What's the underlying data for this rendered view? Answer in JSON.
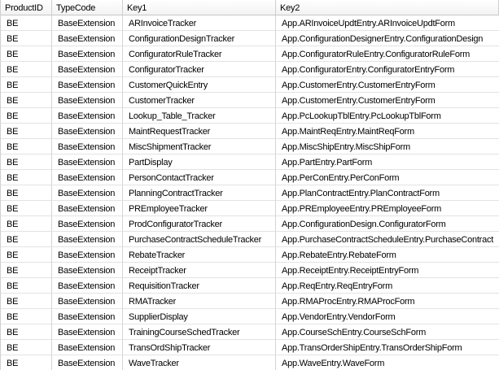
{
  "grid": {
    "columns": [
      "ProductID",
      "TypeCode",
      "Key1",
      "Key2"
    ],
    "rows": [
      {
        "productid": "BE",
        "typecode": "BaseExtension",
        "key1": "ARInvoiceTracker",
        "key2": "App.ARInvoiceUpdtEntry.ARInvoiceUpdtForm"
      },
      {
        "productid": "BE",
        "typecode": "BaseExtension",
        "key1": "ConfigurationDesignTracker",
        "key2": "App.ConfigurationDesignerEntry.ConfigurationDesign"
      },
      {
        "productid": "BE",
        "typecode": "BaseExtension",
        "key1": "ConfiguratorRuleTracker",
        "key2": "App.ConfiguratorRuleEntry.ConfiguratorRuleForm"
      },
      {
        "productid": "BE",
        "typecode": "BaseExtension",
        "key1": "ConfiguratorTracker",
        "key2": "App.ConfiguratorEntry.ConfiguratorEntryForm"
      },
      {
        "productid": "BE",
        "typecode": "BaseExtension",
        "key1": "CustomerQuickEntry",
        "key2": "App.CustomerEntry.CustomerEntryForm"
      },
      {
        "productid": "BE",
        "typecode": "BaseExtension",
        "key1": "CustomerTracker",
        "key2": "App.CustomerEntry.CustomerEntryForm"
      },
      {
        "productid": "BE",
        "typecode": "BaseExtension",
        "key1": "Lookup_Table_Tracker",
        "key2": "App.PcLookupTblEntry.PcLookupTblForm"
      },
      {
        "productid": "BE",
        "typecode": "BaseExtension",
        "key1": "MaintRequestTracker",
        "key2": "App.MaintReqEntry.MaintReqForm"
      },
      {
        "productid": "BE",
        "typecode": "BaseExtension",
        "key1": "MiscShipmentTracker",
        "key2": "App.MiscShipEntry.MiscShipForm"
      },
      {
        "productid": "BE",
        "typecode": "BaseExtension",
        "key1": "PartDisplay",
        "key2": "App.PartEntry.PartForm"
      },
      {
        "productid": "BE",
        "typecode": "BaseExtension",
        "key1": "PersonContactTracker",
        "key2": "App.PerConEntry.PerConForm"
      },
      {
        "productid": "BE",
        "typecode": "BaseExtension",
        "key1": "PlanningContractTracker",
        "key2": "App.PlanContractEntry.PlanContractForm"
      },
      {
        "productid": "BE",
        "typecode": "BaseExtension",
        "key1": "PREmployeeTracker",
        "key2": "App.PREmployeeEntry.PREmployeeForm"
      },
      {
        "productid": "BE",
        "typecode": "BaseExtension",
        "key1": "ProdConfiguratorTracker",
        "key2": "App.ConfigurationDesign.ConfiguratorForm"
      },
      {
        "productid": "BE",
        "typecode": "BaseExtension",
        "key1": "PurchaseContractScheduleTracker",
        "key2": "App.PurchaseContractScheduleEntry.PurchaseContract"
      },
      {
        "productid": "BE",
        "typecode": "BaseExtension",
        "key1": "RebateTracker",
        "key2": "App.RebateEntry.RebateForm"
      },
      {
        "productid": "BE",
        "typecode": "BaseExtension",
        "key1": "ReceiptTracker",
        "key2": "App.ReceiptEntry.ReceiptEntryForm"
      },
      {
        "productid": "BE",
        "typecode": "BaseExtension",
        "key1": "RequisitionTracker",
        "key2": "App.ReqEntry.ReqEntryForm"
      },
      {
        "productid": "BE",
        "typecode": "BaseExtension",
        "key1": "RMATracker",
        "key2": "App.RMAProcEntry.RMAProcForm"
      },
      {
        "productid": "BE",
        "typecode": "BaseExtension",
        "key1": "SupplierDisplay",
        "key2": "App.VendorEntry.VendorForm"
      },
      {
        "productid": "BE",
        "typecode": "BaseExtension",
        "key1": "TrainingCourseSchedTracker",
        "key2": "App.CourseSchEntry.CourseSchForm"
      },
      {
        "productid": "BE",
        "typecode": "BaseExtension",
        "key1": "TransOrdShipTracker",
        "key2": "App.TransOrderShipEntry.TransOrderShipForm"
      },
      {
        "productid": "BE",
        "typecode": "BaseExtension",
        "key1": "WaveTracker",
        "key2": "App.WaveEntry.WaveForm"
      }
    ]
  },
  "colors": {
    "background": "#ffffff",
    "text": "#000000",
    "grid_line_vertical": "#d4d4d4",
    "grid_line_horizontal": "#e3e3e3",
    "header_border": "#c6c6c6",
    "header_background_top": "#ffffff",
    "header_background_bottom": "#f3f3f3"
  }
}
